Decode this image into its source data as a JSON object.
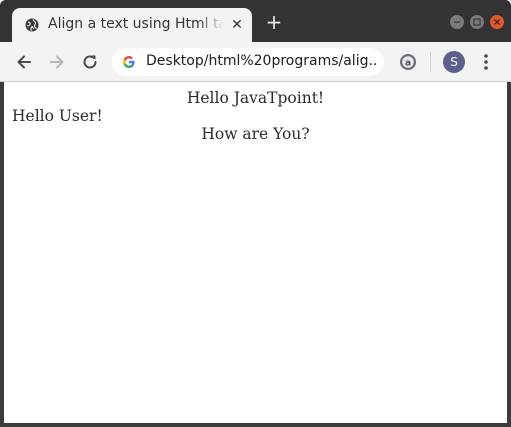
{
  "browser": {
    "tab": {
      "title": "Align a text using Html tag",
      "icon": "globe-icon",
      "close_glyph": "✕"
    },
    "new_tab_glyph": "+",
    "window_controls": {
      "minimize": "minimize-icon",
      "maximize": "maximize-icon",
      "close": "close-icon",
      "close_color": "#e0582a"
    },
    "toolbar": {
      "back": "back-arrow-icon",
      "forward": "forward-arrow-icon",
      "reload": "reload-icon",
      "url": "Desktop/html%20programs/alig...",
      "site_icon": "google-g-icon",
      "extension": "extension-icon",
      "avatar_letter": "S",
      "avatar_color": "#5c5f8f",
      "menu": "kebab-menu-icon"
    }
  },
  "page": {
    "lines": [
      {
        "text": "Hello JavaTpoint!",
        "align": "center"
      },
      {
        "text": "Hello User!",
        "align": "left"
      },
      {
        "text": "How are You?",
        "align": "center"
      }
    ]
  }
}
